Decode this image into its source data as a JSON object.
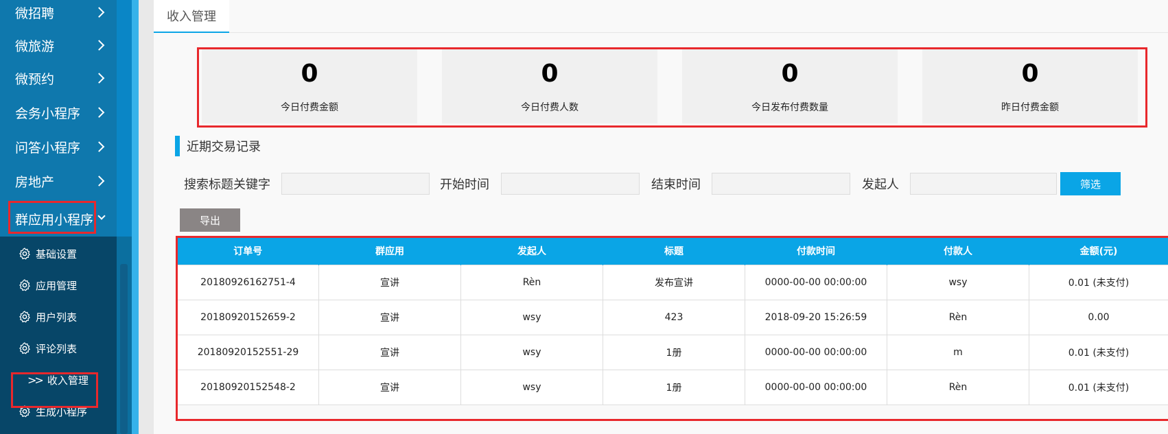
{
  "sidebar": {
    "menu": [
      {
        "label": "微招聘"
      },
      {
        "label": "微旅游"
      },
      {
        "label": "微预约"
      },
      {
        "label": "会务小程序"
      },
      {
        "label": "问答小程序"
      },
      {
        "label": "房地产"
      },
      {
        "label": "群应用小程序"
      }
    ],
    "submenu": [
      {
        "label": "基础设置",
        "icon": "gear-icon"
      },
      {
        "label": "应用管理",
        "icon": "gear-icon"
      },
      {
        "label": "用户列表",
        "icon": "gear-icon"
      },
      {
        "label": "评论列表",
        "icon": "gear-icon"
      },
      {
        "label": "收入管理",
        "icon": "double-chevron-icon"
      },
      {
        "label": "生成小程序",
        "icon": "gear-icon"
      }
    ]
  },
  "tab": {
    "label": "收入管理"
  },
  "stats": [
    {
      "value": "0",
      "label": "今日付费金额"
    },
    {
      "value": "0",
      "label": "今日付费人数"
    },
    {
      "value": "0",
      "label": "今日发布付费数量"
    },
    {
      "value": "0",
      "label": "昨日付费金额"
    }
  ],
  "section": {
    "title": "近期交易记录"
  },
  "filters": {
    "keyword_label": "搜索标题关键字",
    "start_label": "开始时间",
    "end_label": "结束时间",
    "initiator_label": "发起人",
    "filter_button": "筛选",
    "export_button": "导出"
  },
  "table": {
    "headers": [
      "订单号",
      "群应用",
      "发起人",
      "标题",
      "付款时间",
      "付款人",
      "金额(元)"
    ],
    "rows": [
      [
        "20180926162751-4",
        "宣讲",
        "Rèn",
        "发布宣讲",
        "0000-00-00 00:00:00",
        "wsy",
        "0.01 (未支付)"
      ],
      [
        "20180920152659-2",
        "宣讲",
        "wsy",
        "423",
        "2018-09-20 15:26:59",
        "Rèn",
        "0.00"
      ],
      [
        "20180920152551-29",
        "宣讲",
        "wsy",
        "1册",
        "0000-00-00 00:00:00",
        "m",
        "0.01 (未支付)"
      ],
      [
        "20180920152548-2",
        "宣讲",
        "wsy",
        "1册",
        "0000-00-00 00:00:00",
        "Rèn",
        "0.01 (未支付)"
      ]
    ]
  },
  "colors": {
    "accent": "#0aa5e6",
    "sidebar": "#0f78ad",
    "submenu": "#074668",
    "highlight_box": "#e8282c"
  }
}
